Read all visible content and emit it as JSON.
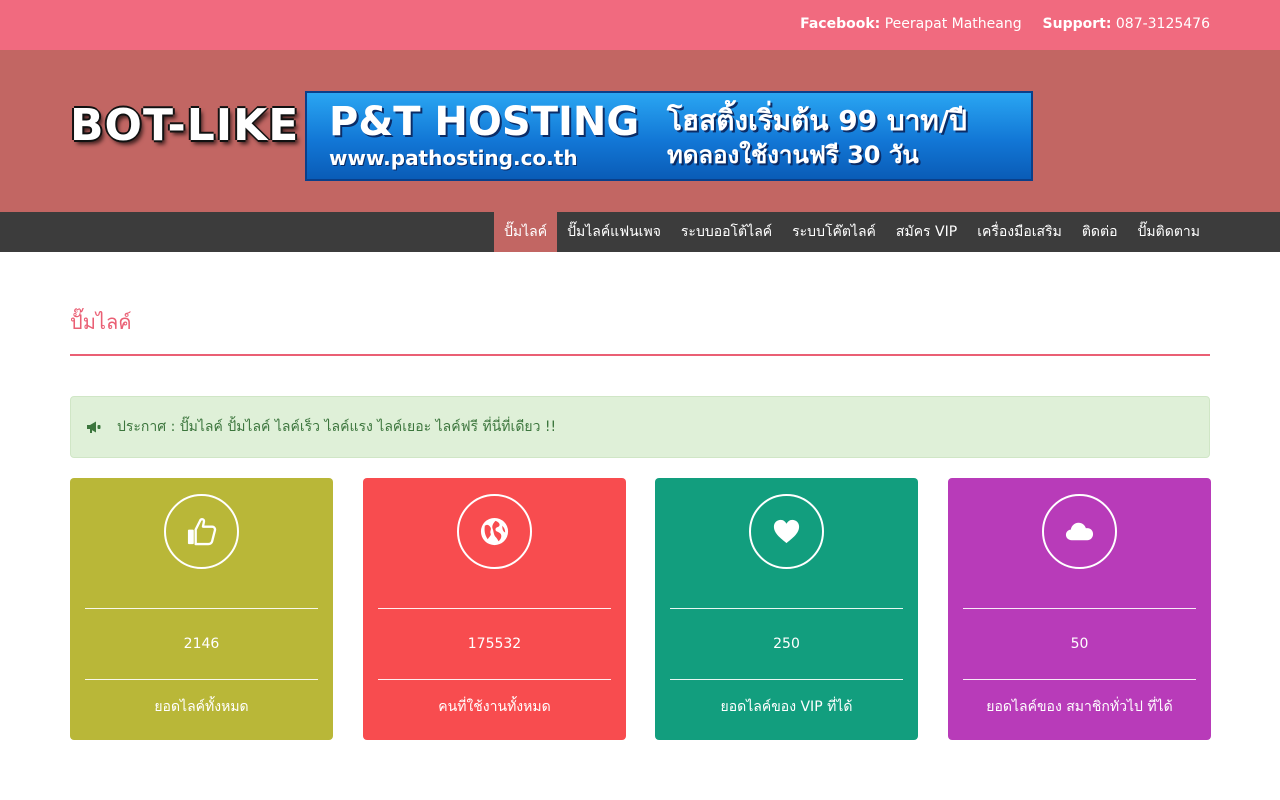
{
  "topbar": {
    "facebook_label": "Facebook:",
    "facebook_value": "Peerapat Matheang",
    "support_label": "Support:",
    "support_value": "087-3125476"
  },
  "header": {
    "logo_text": "BOT-LIKE",
    "banner": {
      "title": "P&T HOSTING",
      "url": "www.pathosting.co.th",
      "line1": "โฮสติ้งเริ่มต้น 99 บาท/ปี",
      "line2": "ทดลองใช้งานฟรี 30 วัน"
    }
  },
  "nav": {
    "items": [
      {
        "label": "ปั๊มไลค์",
        "active": true
      },
      {
        "label": "ปั๊มไลค์แฟนเพจ",
        "active": false
      },
      {
        "label": "ระบบออโต้ไลค์",
        "active": false
      },
      {
        "label": "ระบบโค๊ตไลค์",
        "active": false
      },
      {
        "label": "สมัคร VIP",
        "active": false
      },
      {
        "label": "เครื่องมือเสริม",
        "active": false
      },
      {
        "label": "ติดต่อ",
        "active": false
      },
      {
        "label": "ปั๊มติดตาม",
        "active": false
      }
    ]
  },
  "main": {
    "title": "ปั๊มไลค์",
    "alert": {
      "icon": "bullhorn-icon",
      "text": "ประกาศ : ปั๊มไลค์ ปั้มไลค์ ไลค์เร็ว ไลค์แรง ไลค์เยอะ ไลค์ฟรี ที่นี่ที่เดียว !!"
    },
    "cards": [
      {
        "icon": "thumbs-up-icon",
        "value": "2146",
        "label": "ยอดไลค์ทั้งหมด",
        "color": "#b9b738"
      },
      {
        "icon": "globe-icon",
        "value": "175532",
        "label": "คนที่ใช้งานทั้งหมด",
        "color": "#f84c4f"
      },
      {
        "icon": "heart-icon",
        "value": "250",
        "label": "ยอดไลค์ของ VIP ที่ได้",
        "color": "#129e7e"
      },
      {
        "icon": "cloud-icon",
        "value": "50",
        "label": "ยอดไลค์ของ สมาชิกทั่วไป ที่ได้",
        "color": "#b83bb9"
      }
    ]
  },
  "colors": {
    "topbar": "#f16a7f",
    "header": "#c26663",
    "nav": "#3c3c3c",
    "accent": "#ea5f74",
    "alert_bg": "#dff0d8",
    "alert_text": "#3c763d"
  }
}
